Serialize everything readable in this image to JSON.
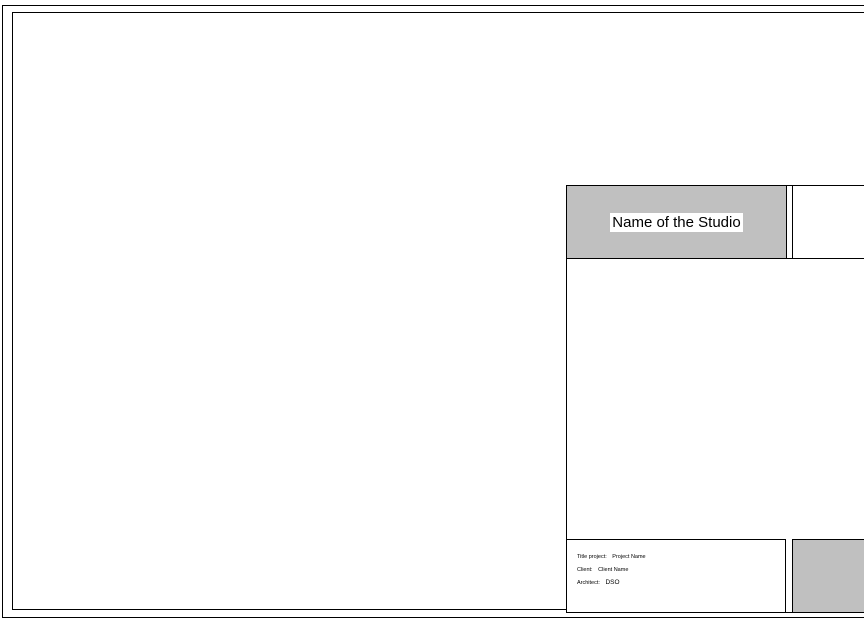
{
  "title_block": {
    "studio_name": "Name of the Studio",
    "rows": [
      {
        "label": "Title project:",
        "value": "Project Name"
      },
      {
        "label": "Client:",
        "value": "Client Name"
      },
      {
        "label": "Architect:",
        "value": "DSO"
      }
    ]
  },
  "colors": {
    "frame_line": "#000000",
    "fill_gray": "#c0c0c0",
    "paper": "#ffffff"
  }
}
